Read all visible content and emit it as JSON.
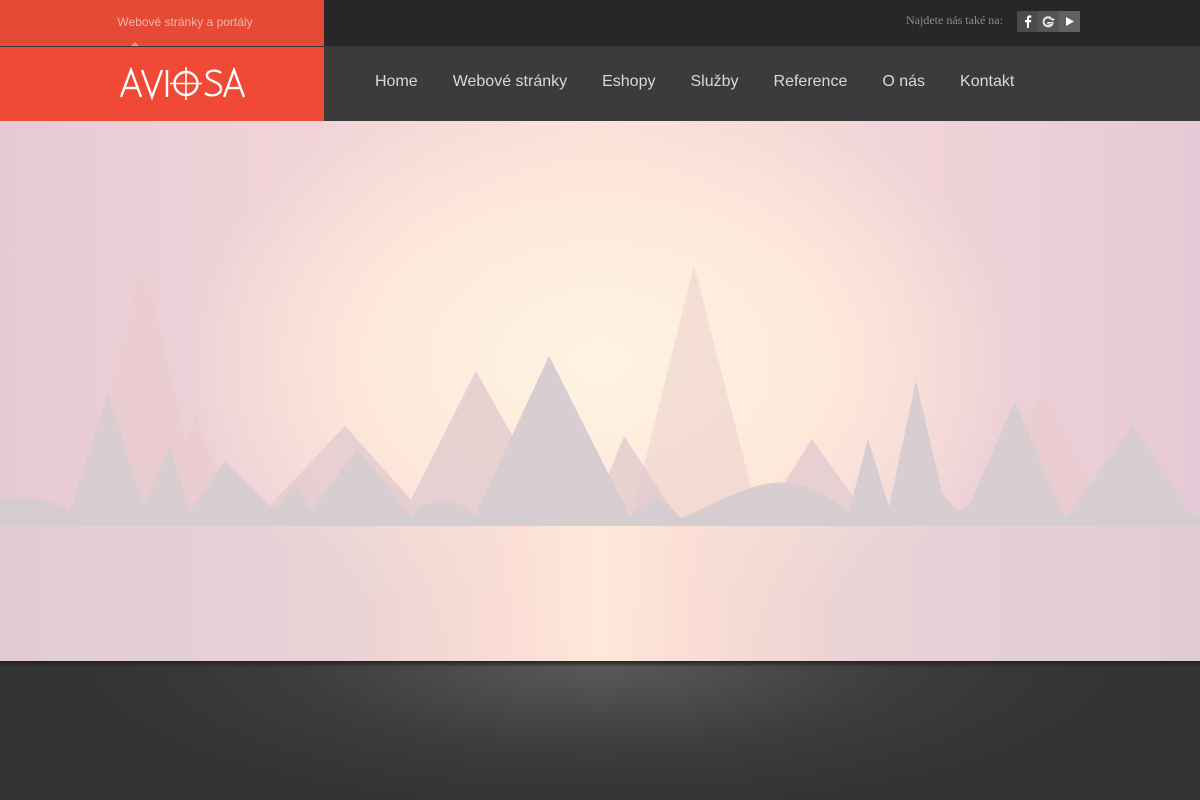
{
  "top": {
    "tagline": "Webové stránky a portály",
    "find_us": "Najdete nás také na:",
    "social": [
      "facebook-icon",
      "google-plus-icon",
      "youtube-icon"
    ]
  },
  "header": {
    "logo_text": "AVIOSA",
    "nav": [
      "Home",
      "Webové stránky",
      "Eshopy",
      "Služby",
      "Reference",
      "O nás",
      "Kontakt"
    ]
  },
  "colors": {
    "brand_red": "#f04a36",
    "top_red": "#e44a35",
    "dark": "#3b3b3b",
    "nav_text": "#d9d9d9"
  }
}
